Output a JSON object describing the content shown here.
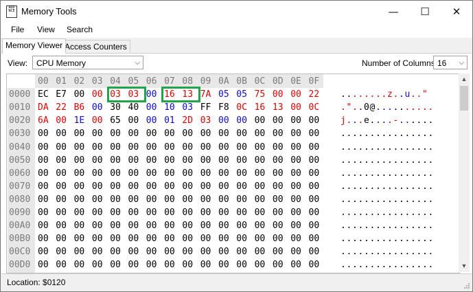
{
  "window": {
    "title": "Memory Tools",
    "app_icon_text": "ADD\nNCE"
  },
  "titlebar_buttons": {
    "minimize": "—",
    "maximize": "☐",
    "close": "✕"
  },
  "menu": [
    "File",
    "View",
    "Search"
  ],
  "tabs": [
    {
      "label": "Memory Viewer",
      "active": true
    },
    {
      "label": "Access Counters",
      "active": false
    }
  ],
  "toolbar": {
    "view_label": "View:",
    "view_value": "CPU Memory",
    "columns_label": "Number of Columns:",
    "columns_value": "16"
  },
  "hex": {
    "header": [
      "00",
      "01",
      "02",
      "03",
      "04",
      "05",
      "06",
      "07",
      "08",
      "09",
      "0A",
      "0B",
      "0C",
      "0D",
      "0E",
      "0F"
    ],
    "colors": {
      "k": "#000000",
      "r": "#e00000",
      "b": "#0a0ad8"
    },
    "rows": [
      {
        "addr": "0000",
        "bytes": [
          "EC",
          "E7",
          "00",
          "00",
          "03",
          "03",
          "00",
          "16",
          "13",
          "7A",
          "05",
          "05",
          "75",
          "00",
          "00",
          "22"
        ],
        "colors": "kkkrrrbrrrbbrrrr",
        "ascii": "........z..u..\"",
        "ascii_colors": "kkrrrrrrrrbbrrrr"
      },
      {
        "addr": "0010",
        "bytes": [
          "DA",
          "22",
          "B6",
          "00",
          "30",
          "40",
          "00",
          "10",
          "03",
          "FF",
          "F8",
          "0C",
          "16",
          "13",
          "00",
          "0C"
        ],
        "colors": "rrrbkkbbbkkrrrrr",
        "ascii": ".\"..0@..........",
        "ascii_colors": "rrrbkkbbbkkrrrrr"
      },
      {
        "addr": "0020",
        "bytes": [
          "6A",
          "00",
          "1E",
          "00",
          "65",
          "00",
          "00",
          "01",
          "2D",
          "03",
          "00",
          "00",
          "00",
          "00",
          "00",
          "00"
        ],
        "colors": "rrbrkkbbrrbbkkkk",
        "ascii": "j...e....-......",
        "ascii_colors": "rrbrkkbbrrbbkkkk"
      },
      {
        "addr": "0030",
        "bytes": [
          "00",
          "00",
          "00",
          "00",
          "00",
          "00",
          "00",
          "00",
          "00",
          "00",
          "00",
          "00",
          "00",
          "00",
          "00",
          "00"
        ],
        "colors": "kkkkkkkkkkkkkkkk",
        "ascii": "................",
        "ascii_colors": "kkkkkkkkkkkkkkkk"
      },
      {
        "addr": "0040",
        "bytes": [
          "00",
          "00",
          "00",
          "00",
          "00",
          "00",
          "00",
          "00",
          "00",
          "00",
          "00",
          "00",
          "00",
          "00",
          "00",
          "00"
        ],
        "colors": "kkkkkkkkkkkkkkkk",
        "ascii": "................",
        "ascii_colors": "kkkkkkkkkkkkkkkk"
      },
      {
        "addr": "0050",
        "bytes": [
          "00",
          "00",
          "00",
          "00",
          "00",
          "00",
          "00",
          "00",
          "00",
          "00",
          "00",
          "00",
          "00",
          "00",
          "00",
          "00"
        ],
        "colors": "kkkkkkkkkkkkkkkk",
        "ascii": "................",
        "ascii_colors": "kkkkkkkkkkkkkkkk"
      },
      {
        "addr": "0060",
        "bytes": [
          "00",
          "00",
          "00",
          "00",
          "00",
          "00",
          "00",
          "00",
          "00",
          "00",
          "00",
          "00",
          "00",
          "00",
          "00",
          "00"
        ],
        "colors": "kkkkkkkkkkkkkkkk",
        "ascii": "................",
        "ascii_colors": "kkkkkkkkkkkkkkkk"
      },
      {
        "addr": "0070",
        "bytes": [
          "00",
          "00",
          "00",
          "00",
          "00",
          "00",
          "00",
          "00",
          "00",
          "00",
          "00",
          "00",
          "00",
          "00",
          "00",
          "00"
        ],
        "colors": "kkkkkkkkkkkkkkkk",
        "ascii": "................",
        "ascii_colors": "kkkkkkkkkkkkkkkk"
      },
      {
        "addr": "0080",
        "bytes": [
          "00",
          "00",
          "00",
          "00",
          "00",
          "00",
          "00",
          "00",
          "00",
          "00",
          "00",
          "00",
          "00",
          "00",
          "00",
          "00"
        ],
        "colors": "kkkkkkkkkkkkkkkk",
        "ascii": "................",
        "ascii_colors": "kkkkkkkkkkkkkkkk"
      },
      {
        "addr": "0090",
        "bytes": [
          "00",
          "00",
          "00",
          "00",
          "00",
          "00",
          "00",
          "00",
          "00",
          "00",
          "00",
          "00",
          "00",
          "00",
          "00",
          "00"
        ],
        "colors": "kkkkkkkkkkkkkkkk",
        "ascii": "................",
        "ascii_colors": "kkkkkkkkkkkkkkkk"
      },
      {
        "addr": "00A0",
        "bytes": [
          "00",
          "00",
          "00",
          "00",
          "00",
          "00",
          "00",
          "00",
          "00",
          "00",
          "00",
          "00",
          "00",
          "00",
          "00",
          "00"
        ],
        "colors": "kkkkkkkkkkkkkkkk",
        "ascii": "................",
        "ascii_colors": "kkkkkkkkkkkkkkkk"
      },
      {
        "addr": "00B0",
        "bytes": [
          "00",
          "00",
          "00",
          "00",
          "00",
          "00",
          "00",
          "00",
          "00",
          "00",
          "00",
          "00",
          "00",
          "00",
          "00",
          "00"
        ],
        "colors": "kkkkkkkkkkkkkkkk",
        "ascii": "................",
        "ascii_colors": "kkkkkkkkkkkkkkkk"
      },
      {
        "addr": "00C0",
        "bytes": [
          "00",
          "00",
          "00",
          "00",
          "00",
          "00",
          "00",
          "00",
          "00",
          "00",
          "00",
          "00",
          "00",
          "00",
          "00",
          "00"
        ],
        "colors": "kkkkkkkkkkkkkkkk",
        "ascii": "................",
        "ascii_colors": "kkkkkkkkkkkkkkkk"
      },
      {
        "addr": "00D0",
        "bytes": [
          "00",
          "00",
          "00",
          "00",
          "00",
          "00",
          "00",
          "00",
          "00",
          "00",
          "00",
          "00",
          "00",
          "00",
          "00",
          "00"
        ],
        "colors": "kkkkkkkkkkkkkkkk",
        "ascii": "................",
        "ascii_colors": "kkkkkkkkkkkkkkkk"
      }
    ],
    "highlights": [
      {
        "row": 0,
        "from_col": 4,
        "to_col": 5,
        "color": "#1ea64a"
      },
      {
        "row": 0,
        "from_col": 7,
        "to_col": 8,
        "color": "#1ea64a"
      }
    ]
  },
  "status": {
    "location": "Location: $0120"
  }
}
